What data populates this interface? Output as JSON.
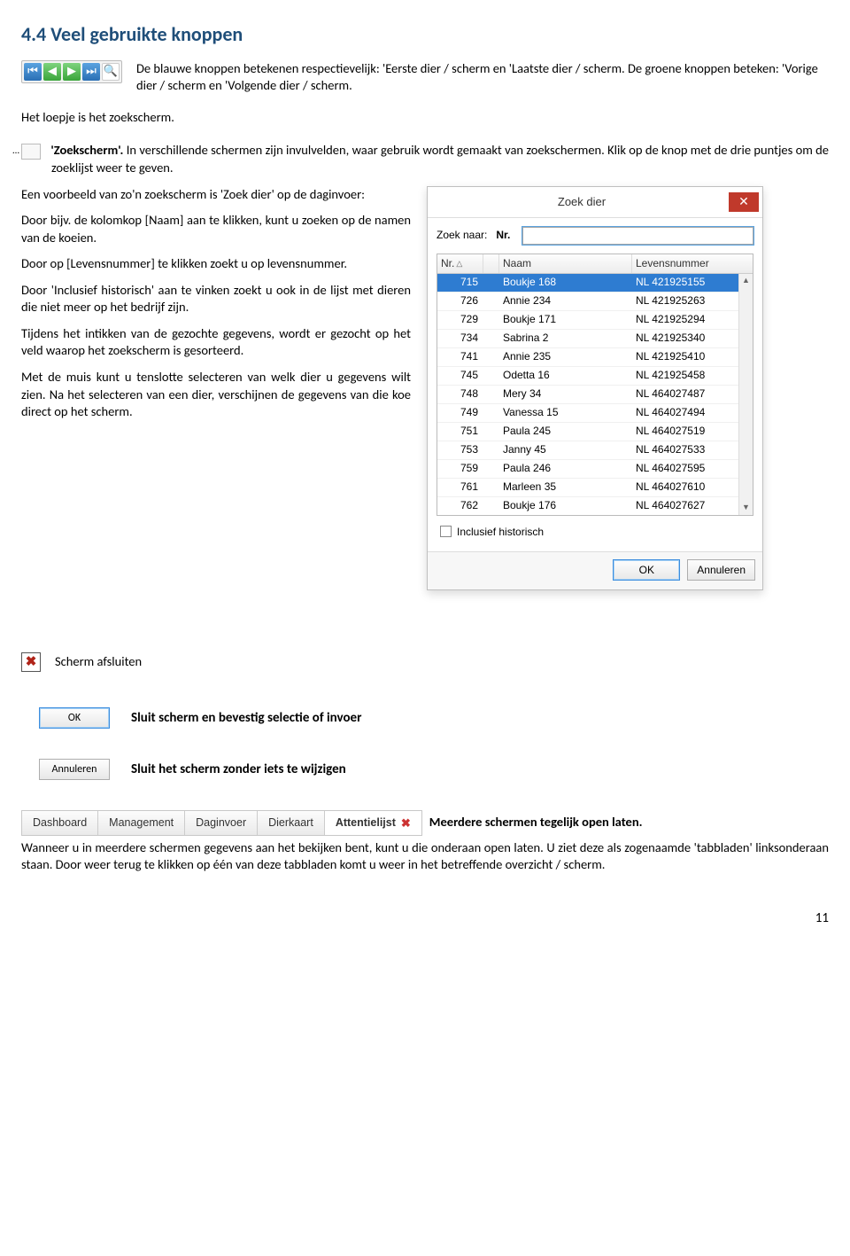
{
  "heading": "4.4 Veel gebruikte knoppen",
  "intro_p1_a": "De blauwe knoppen betekenen respectievelijk: 'Eerste dier / scherm en 'Laatste dier / scherm. De groene knoppen beteken: 'Vorige dier / scherm en 'Volgende dier / scherm.",
  "intro_p1_b": "Het loepje is het zoekscherm.",
  "zoekscherm_bold": "'Zoekscherm'.",
  "zoekscherm_rest": " In verschillende schermen zijn invulvelden, waar gebruik wordt gemaakt van zoekschermen.  Klik op de knop met de drie puntjes om de zoeklijst weer te geven.",
  "para1": "Een voorbeeld van zo'n zoekscherm is 'Zoek dier' op de daginvoer:",
  "para2": "Door bijv. de kolomkop [Naam] aan te klikken, kunt u zoeken op de namen van de koeien.",
  "para3": "Door op [Levensnummer] te klikken zoekt u op levensnummer.",
  "para4": "Door 'Inclusief historisch' aan te vinken zoekt u ook in de lijst met dieren die niet meer op het bedrijf zijn.",
  "para5": "Tijdens het intikken van de gezochte gegevens, wordt er gezocht op het veld waarop het zoekscherm is gesorteerd.",
  "para6": "Met de muis kunt u tenslotte selecteren van welk dier u gegevens wilt zien. Na het selecteren van een dier, verschijnen de gegevens van die koe direct op het scherm.",
  "dialog": {
    "title": "Zoek dier",
    "search_label": "Zoek naar:",
    "search_field_name": "Nr.",
    "search_value": "",
    "cols": {
      "nr": "Nr.",
      "naam": "Naam",
      "lev": "Levensnummer"
    },
    "rows": [
      {
        "nr": "715",
        "naam": "Boukje 168",
        "lev": "NL 421925155"
      },
      {
        "nr": "726",
        "naam": "Annie 234",
        "lev": "NL 421925263"
      },
      {
        "nr": "729",
        "naam": "Boukje 171",
        "lev": "NL 421925294"
      },
      {
        "nr": "734",
        "naam": "Sabrina 2",
        "lev": "NL 421925340"
      },
      {
        "nr": "741",
        "naam": "Annie 235",
        "lev": "NL 421925410"
      },
      {
        "nr": "745",
        "naam": "Odetta 16",
        "lev": "NL 421925458"
      },
      {
        "nr": "748",
        "naam": "Mery 34",
        "lev": "NL 464027487"
      },
      {
        "nr": "749",
        "naam": "Vanessa 15",
        "lev": "NL 464027494"
      },
      {
        "nr": "751",
        "naam": "Paula 245",
        "lev": "NL 464027519"
      },
      {
        "nr": "753",
        "naam": "Janny 45",
        "lev": "NL 464027533"
      },
      {
        "nr": "759",
        "naam": "Paula 246",
        "lev": "NL 464027595"
      },
      {
        "nr": "761",
        "naam": "Marleen 35",
        "lev": "NL 464027610"
      },
      {
        "nr": "762",
        "naam": "Boukje 176",
        "lev": "NL 464027627"
      }
    ],
    "hist_label": "Inclusief historisch",
    "ok": "OK",
    "cancel": "Annuleren"
  },
  "scherm_afsluiten": "Scherm afsluiten",
  "ok_caption": "Sluit scherm en bevestig selectie of invoer",
  "ann_caption": "Sluit het scherm zonder iets te wijzigen",
  "ok_label": "OK",
  "ann_label": "Annuleren",
  "tabs": [
    "Dashboard",
    "Management",
    "Daginvoer",
    "Dierkaart",
    "Attentielijst"
  ],
  "tabs_caption": "Meerdere schermen tegelijk open laten.",
  "tabs_para": "Wanneer u in meerdere schermen gegevens aan het bekijken bent, kunt u die onderaan open laten. U ziet deze als zogenaamde 'tabbladen' linksonderaan staan. Door weer terug te klikken op één van deze tabbladen komt u weer in het betreffende overzicht / scherm.",
  "page_num": "11"
}
